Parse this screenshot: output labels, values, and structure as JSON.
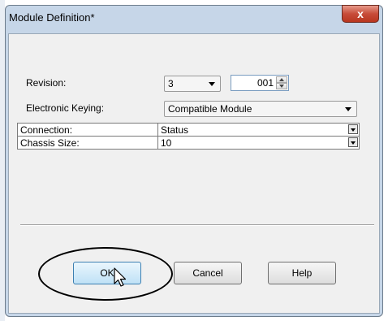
{
  "window": {
    "title": "Module Definition*",
    "close_label": "x"
  },
  "form": {
    "revision_label": "Revision:",
    "revision_major": "3",
    "revision_minor": "001",
    "keying_label": "Electronic Keying:",
    "keying_value": "Compatible Module"
  },
  "grid": {
    "rows": [
      {
        "name": "Connection:",
        "value": "Status"
      },
      {
        "name": "Chassis Size:",
        "value": "10"
      }
    ]
  },
  "buttons": {
    "ok": "OK",
    "cancel": "Cancel",
    "help": "Help"
  },
  "colors": {
    "accent": "#3c7fb1",
    "close": "#c74c39"
  }
}
